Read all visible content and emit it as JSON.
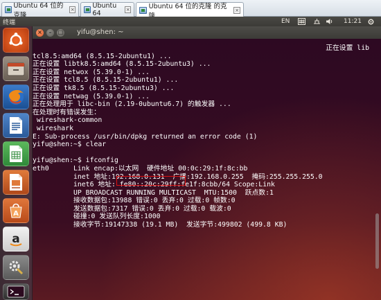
{
  "vm_tabs": [
    {
      "label": "Ubuntu 64 位的克隆",
      "active": false
    },
    {
      "label": "Ubuntu 64",
      "active": false
    },
    {
      "label": "Ubuntu 64 位的克隆 的克隆",
      "active": true
    }
  ],
  "top_panel": {
    "app_name": "终端",
    "input_method": "EN",
    "time": "11:21"
  },
  "launcher": {
    "items": [
      {
        "name": "dash-home-icon"
      },
      {
        "name": "files-icon"
      },
      {
        "name": "firefox-icon"
      },
      {
        "name": "writer-icon"
      },
      {
        "name": "calc-icon"
      },
      {
        "name": "impress-icon"
      },
      {
        "name": "software-center-icon"
      },
      {
        "name": "amazon-icon"
      },
      {
        "name": "system-settings-icon"
      },
      {
        "name": "terminal-icon"
      }
    ]
  },
  "terminal": {
    "title": "yifu@shen: ~",
    "lines": [
      {
        "text": "正在设置 lib",
        "align": "right"
      },
      {
        "text": "tcl8.5:amd64 (8.5.15-2ubuntu1) ..."
      },
      {
        "text": "正在设置 libtk8.5:amd64 (8.5.15-2ubuntu3) ..."
      },
      {
        "text": "正在设置 netwox (5.39.0-1) ..."
      },
      {
        "text": "正在设置 tcl8.5 (8.5.15-2ubuntu1) ..."
      },
      {
        "text": "正在设置 tk8.5 (8.5.15-2ubuntu3) ..."
      },
      {
        "text": "正在设置 netwag (5.39.0-1) ..."
      },
      {
        "text": "正在处理用于 libc-bin (2.19-0ubuntu6.7) 的触发器 ..."
      },
      {
        "text": "在处理时有错误发生："
      },
      {
        "text": " wireshark-common"
      },
      {
        "text": " wireshark"
      },
      {
        "text": "E: Sub-process /usr/bin/dpkg returned an error code (1)"
      },
      {
        "text": "yifu@shen:~$ clear"
      },
      {
        "text": ""
      },
      {
        "text": "yifu@shen:~$ ifconfig"
      },
      {
        "text": "eth0      Link encap:以太网  硬件地址 00:0c:29:1f:8c:bb"
      },
      {
        "text": "          inet 地址:192.168.0.131  广播:192.168.0.255  掩码:255.255.255.0"
      },
      {
        "text": "          inet6 地址: fe80::20c:29ff:fe1f:8cbb/64 Scope:Link"
      },
      {
        "text": "          UP BROADCAST RUNNING MULTICAST  MTU:1500  跃点数:1"
      },
      {
        "text": "          接收数据包:13988 错误:0 丢弃:0 过载:0 帧数:0"
      },
      {
        "text": "          发送数据包:7317 错误:0 丢弃:0 过载:0 载波:0"
      },
      {
        "text": "          碰撞:0 发送队列长度:1000"
      },
      {
        "text": "          接收字节:19147338 (19.1 MB)  发送字节:499802 (499.8 KB)"
      }
    ],
    "highlight_color": "#dd1111"
  }
}
